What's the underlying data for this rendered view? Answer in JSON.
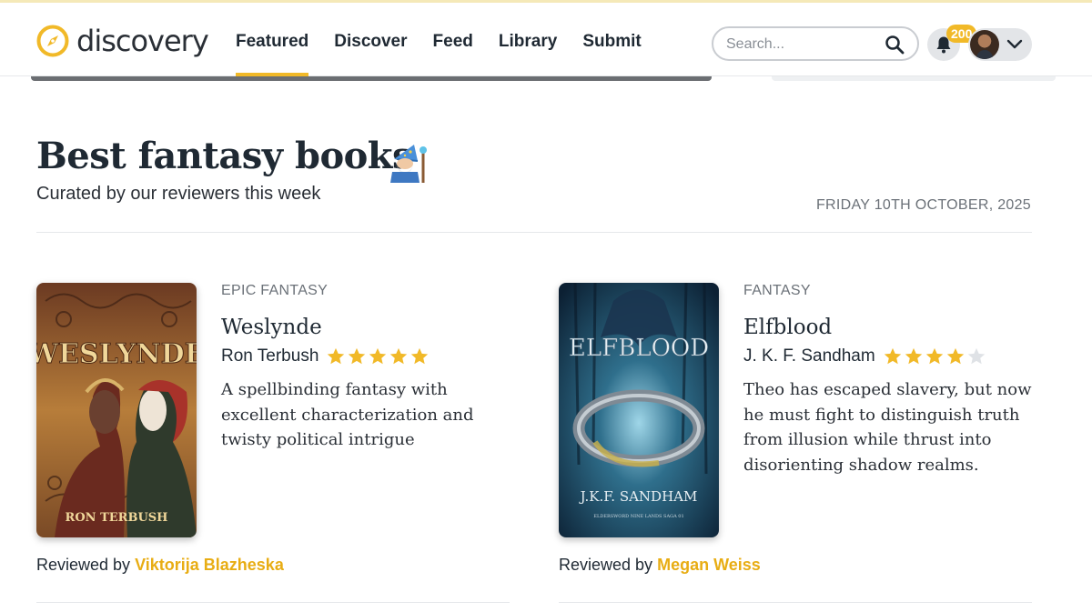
{
  "header": {
    "logo_text": "discovery",
    "nav": [
      {
        "label": "Featured",
        "active": true
      },
      {
        "label": "Discover",
        "active": false
      },
      {
        "label": "Feed",
        "active": false
      },
      {
        "label": "Library",
        "active": false
      },
      {
        "label": "Submit",
        "active": false
      }
    ],
    "search_placeholder": "Search...",
    "notification_count": "200",
    "accent_color": "#f1b928"
  },
  "page": {
    "title": "Best fantasy books",
    "title_icon": "wizard-emoji",
    "subtitle": "Curated by our reviewers this week",
    "date": "FRIDAY 10TH OCTOBER, 2025"
  },
  "books": [
    {
      "genre": "EPIC FANTASY",
      "title": "Weslynde",
      "author": "Ron Terbush",
      "rating": 5,
      "blurb": "A spellbinding fantasy with excellent characterization and twisty political intrigue",
      "reviewed_by_label": "Reviewed by",
      "reviewer": "Viktorija Blazheska",
      "cover_title": "WESLYNDE",
      "cover_author": "RON TERBUSH"
    },
    {
      "genre": "FANTASY",
      "title": "Elfblood",
      "author": "J. K. F. Sandham",
      "rating": 4,
      "blurb": "Theo has escaped slavery, but now he must fight to distinguish truth from illusion while thrust into disorienting shadow realms.",
      "reviewed_by_label": "Reviewed by",
      "reviewer": "Megan Weiss",
      "cover_title": "ELFBLOOD",
      "cover_author": "J.K.F. SANDHAM",
      "cover_series": "ELDERSWORD NINE LANDS SAGA 01"
    }
  ]
}
